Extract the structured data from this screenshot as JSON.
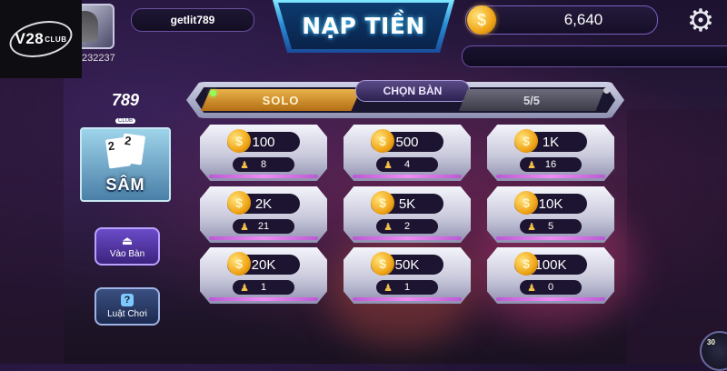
{
  "brand": {
    "name": "V28",
    "suffix": "CLUB"
  },
  "header": {
    "username": "getlit789",
    "user_id_partial": "232237",
    "top_up_label": "NẠP TIỀN",
    "balance": "6,640",
    "coin_symbol": "$",
    "settings_icon": "gear-icon"
  },
  "tabs": {
    "solo_label": "SOLO",
    "choose_table_label": "CHỌN BÀN",
    "count_label": "5/5"
  },
  "sidebar": {
    "game_logo_number": "789",
    "game_logo_club": "CLUB",
    "game_name": "SÂM",
    "card_a": "2",
    "card_b": "2",
    "join_label": "Vào Bàn",
    "rules_label": "Luật Chơi",
    "rules_icon_glyph": "?"
  },
  "tables": [
    {
      "amount": "100",
      "players": "8"
    },
    {
      "amount": "500",
      "players": "4"
    },
    {
      "amount": "1K",
      "players": "16"
    },
    {
      "amount": "2K",
      "players": "21"
    },
    {
      "amount": "5K",
      "players": "2"
    },
    {
      "amount": "10K",
      "players": "5"
    },
    {
      "amount": "20K",
      "players": "1"
    },
    {
      "amount": "50K",
      "players": "1"
    },
    {
      "amount": "100K",
      "players": "0"
    }
  ],
  "corner": {
    "badge_text": "30"
  },
  "colors": {
    "accent_gold": "#f0a516",
    "accent_blue": "#2a8ed8",
    "solo_tab": "#e9b24a",
    "join_button": "#6b4bc8"
  }
}
